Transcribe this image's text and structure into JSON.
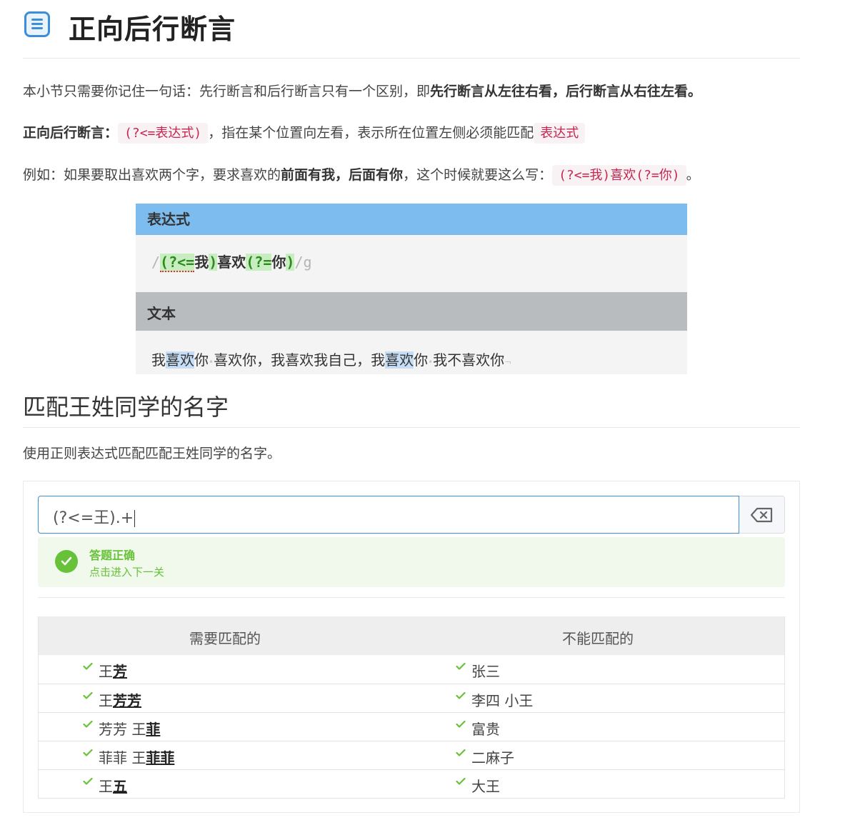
{
  "header": {
    "title": "正向后行断言",
    "icon": "document-icon"
  },
  "intro": {
    "p1_prefix": "本小节只需要你记住一句话：先行断言和后行断言只有一个区别，即",
    "p1_bold": "先行断言从左往右看，后行断言从右往左看。",
    "p2_bold": "正向后行断言：",
    "p2_code": "(?<=表达式)",
    "p2_mid": "，指在某个位置向左看，表示所在位置左侧必须能匹配",
    "p2_code2": "表达式",
    "p3_a": "例如：如果要取出喜欢两个字，要求喜欢的",
    "p3_b1": "前面有我",
    "p3_sep": "，",
    "p3_b2": "后面有你",
    "p3_c": "，这个时候就要这么写：",
    "p3_code": "(?<=我)喜欢(?=你)",
    "p3_end": "。"
  },
  "demo": {
    "expr_header": "表达式",
    "slash_open": "/",
    "g1": "(?<=",
    "g1_text": "我",
    "g1_close": ")",
    "mid": "喜欢",
    "g2": "(?=",
    "g2_text": "你",
    "g2_close": ")",
    "slash_close": "/g",
    "text_header": "文本",
    "t1": "我",
    "t2": "喜欢",
    "t3": "你",
    "t4": "喜欢你，我喜欢我自己，我",
    "t5": "喜欢",
    "t6": "你",
    "t7": "我不喜欢你",
    "dot": "•",
    "end_mark": "¬"
  },
  "section": {
    "title": "匹配王姓同学的名字",
    "desc": "使用正则表达式匹配匹配王姓同学的名字。"
  },
  "quiz": {
    "input_value": "(?<=王).+",
    "success_title": "答题正确",
    "success_sub": "点击进入下一关",
    "col_match": "需要匹配的",
    "col_nomatch": "不能匹配的",
    "rows": [
      {
        "m_pre": "王",
        "m_hit": "芳",
        "n": "张三"
      },
      {
        "m_pre": "王",
        "m_hit": "芳芳",
        "n": "李四 小王"
      },
      {
        "m_pre": "芳芳 王",
        "m_hit": "菲",
        "n": "富贵"
      },
      {
        "m_pre": "菲菲 王",
        "m_hit": "菲菲",
        "n": "二麻子"
      },
      {
        "m_pre": "王",
        "m_hit": "五",
        "n": "大王"
      }
    ]
  },
  "colors": {
    "accent": "#3d8ed8",
    "success": "#67c23a",
    "code": "#c7254e",
    "demo_header": "#7dbcee"
  }
}
